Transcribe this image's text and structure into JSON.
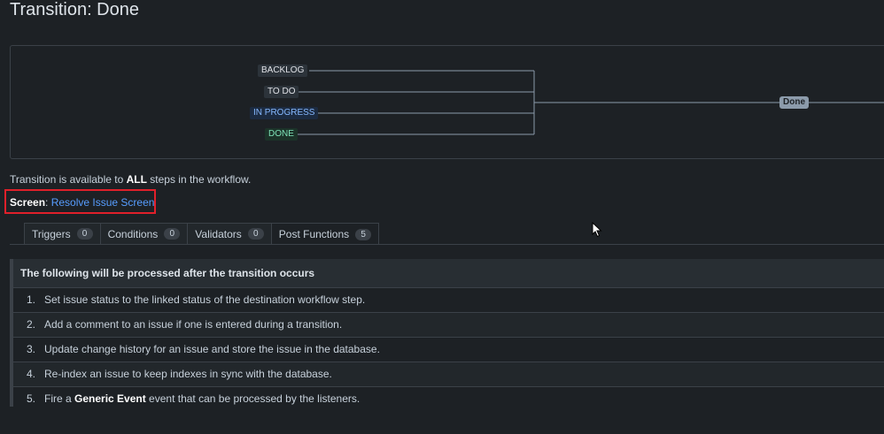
{
  "page_title": "Transition: Done",
  "diagram": {
    "source_statuses": [
      {
        "label": "BACKLOG",
        "style": "gray"
      },
      {
        "label": "TO DO",
        "style": "gray"
      },
      {
        "label": "IN PROGRESS",
        "style": "blue"
      },
      {
        "label": "DONE",
        "style": "green"
      }
    ],
    "target_label": "Done"
  },
  "availability": {
    "prefix": "Transition is available to ",
    "emphasis": "ALL",
    "suffix": " steps in the workflow."
  },
  "screen": {
    "label": "Screen",
    "separator": ": ",
    "link_text": "Resolve Issue Screen"
  },
  "tabs": [
    {
      "label": "Triggers",
      "count": "0",
      "active": false
    },
    {
      "label": "Conditions",
      "count": "0",
      "active": false
    },
    {
      "label": "Validators",
      "count": "0",
      "active": false
    },
    {
      "label": "Post Functions",
      "count": "5",
      "active": true
    }
  ],
  "post_functions": {
    "heading": "The following will be processed after the transition occurs",
    "items": [
      {
        "num": "1.",
        "pre": "Set issue status to the linked status of the destination workflow step.",
        "bold": "",
        "post": ""
      },
      {
        "num": "2.",
        "pre": "Add a comment to an issue if one is entered during a transition.",
        "bold": "",
        "post": ""
      },
      {
        "num": "3.",
        "pre": "Update change history for an issue and store the issue in the database.",
        "bold": "",
        "post": ""
      },
      {
        "num": "4.",
        "pre": "Re-index an issue to keep indexes in sync with the database.",
        "bold": "",
        "post": ""
      },
      {
        "num": "5.",
        "pre": "Fire a ",
        "bold": "Generic Event",
        "post": " event that can be processed by the listeners."
      }
    ]
  },
  "colors": {
    "background": "#1d2125",
    "link": "#579dff",
    "highlight_box": "#e0202a"
  }
}
